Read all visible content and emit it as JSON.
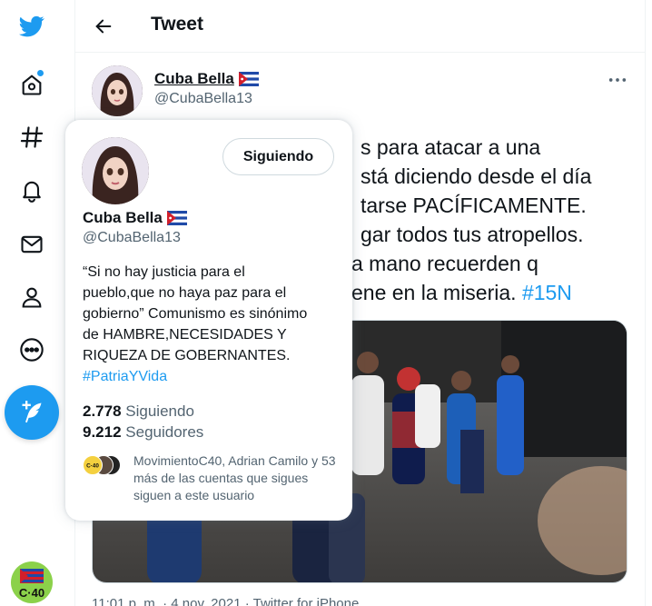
{
  "header": {
    "title": "Tweet"
  },
  "nav": {
    "items": [
      "twitter-logo",
      "home-icon",
      "explore-icon",
      "notifications-icon",
      "messages-icon",
      "profile-icon",
      "more-icon"
    ],
    "accent": "#1d9bf0"
  },
  "tweet": {
    "author_name": "Cuba Bella",
    "author_handle": "@CubaBella13",
    "text_lines": [
      "s para atacar a una",
      "stá diciendo desde el día",
      "tarse PACÍFICAMENTE.",
      "gar todos tus atropellos.",
      "a mano recuerden q",
      "ene en la miseria."
    ],
    "hashtag": "#15N",
    "meta": "11:01 p. m. · 4 nov. 2021 · Twitter for iPhone"
  },
  "hovercard": {
    "name": "Cuba Bella",
    "handle": "@CubaBella13",
    "follow_label": "Siguiendo",
    "bio_lines": [
      "“Si no hay justicia para el",
      "pueblo,que no haya paz para el",
      "gobierno” Comunismo es sinónimo",
      "de HAMBRE,NECESIDADES Y",
      "RIQUEZA DE GOBERNANTES."
    ],
    "bio_hashtag": "#PatriaYVida",
    "following_count": "2.778",
    "following_label": "Siguiendo",
    "followers_count": "9.212",
    "followers_label": "Seguidores",
    "mutual_text": "MovimientoC40, Adrian Camilo y 53 más de las cuentas que sigues siguen a este usuario"
  }
}
